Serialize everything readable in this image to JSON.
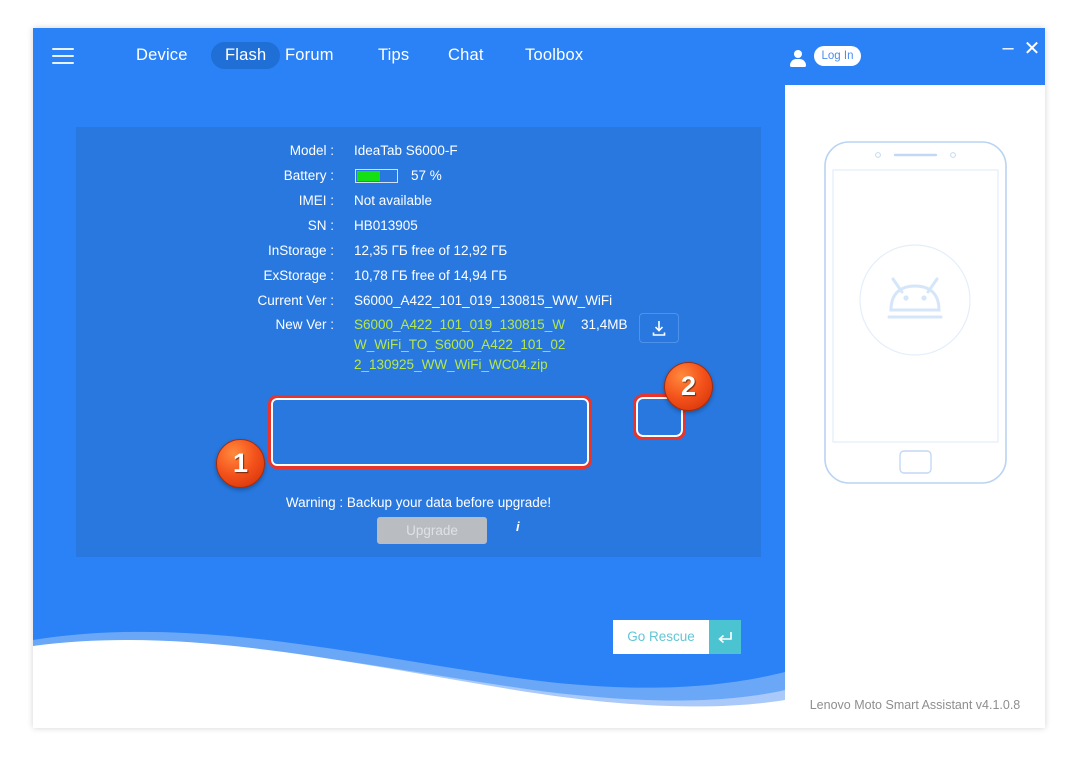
{
  "window": {
    "minimize_label": "–",
    "close_label": "✕"
  },
  "topbar": {
    "menu_icon": "hamburger-icon",
    "nav": [
      {
        "label": "Device",
        "active": false
      },
      {
        "label": "Flash",
        "active": true
      },
      {
        "label": "Forum",
        "active": false
      },
      {
        "label": "Tips",
        "active": false
      },
      {
        "label": "Chat",
        "active": false
      },
      {
        "label": "Toolbox",
        "active": false
      }
    ],
    "account_icon": "user-icon",
    "login_label": "Log In"
  },
  "device_info": {
    "rows": [
      {
        "label": "Model :",
        "value": "IdeaTab S6000-F"
      },
      {
        "label": "Battery :",
        "value": "57 %"
      },
      {
        "label": "IMEI :",
        "value": "Not available"
      },
      {
        "label": "SN :",
        "value": "HB013905"
      },
      {
        "label": "InStorage :",
        "value": "12,35 ГБ free of 12,92 ГБ"
      },
      {
        "label": "ExStorage :",
        "value": "10,78 ГБ free of 14,94 ГБ"
      },
      {
        "label": "Current Ver :",
        "value": "S6000_A422_101_019_130815_WW_WiFi"
      }
    ],
    "battery": {
      "percent_label": "57 %",
      "percent_value": 57,
      "fill_color": "#14e014"
    },
    "new_version": {
      "label": "New Ver :",
      "value": "S6000_A422_101_019_130815_WW_WiFi_TO_S6000_A422_101_022_130925_WW_WiFi_WC04.zip",
      "size": "31,4MB",
      "text_color": "#b6e84a",
      "download_icon": "download-icon"
    }
  },
  "actions": {
    "warning": "Warning : Backup your data before upgrade!",
    "upgrade_label": "Upgrade",
    "upgrade_disabled": true,
    "info_icon_label": "i",
    "rescue_label": "Go Rescue",
    "rescue_arrow_icon": "return-arrow-icon"
  },
  "annotations": {
    "badge_one": "1",
    "badge_two": "2",
    "highlight_color": "#e8342a"
  },
  "right_panel": {
    "device_preview_icon": "android-phone-illustration",
    "app_version": "Lenovo Moto Smart Assistant v4.1.0.8"
  },
  "colors": {
    "window_blue": "#2b82f6",
    "panel_blue": "#2878e0",
    "accent_green": "#b6e84a",
    "teal": "#4cc3d0"
  }
}
